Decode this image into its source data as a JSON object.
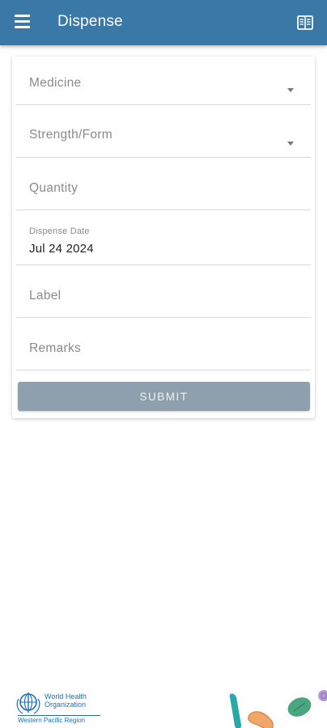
{
  "appbar": {
    "title": "Dispense",
    "menu_icon": "hamburger-menu-icon",
    "book_icon": "open-book-icon",
    "color": "#3a78a8"
  },
  "form": {
    "medicine_label": "Medicine",
    "strength_label": "Strength/Form",
    "quantity_label": "Quantity",
    "dispense_date_label": "Dispense Date",
    "dispense_date_value": "Jul 24 2024",
    "label_label": "Label",
    "remarks_label": "Remarks",
    "submit_label": "SUBMIT",
    "submit_color": "#8ea0ad"
  },
  "footer": {
    "org_name": "World Health Organization",
    "region": "Western Pacific Region",
    "logo_icon": "who-emblem-icon",
    "decor": "medicine-pills-illustration"
  }
}
